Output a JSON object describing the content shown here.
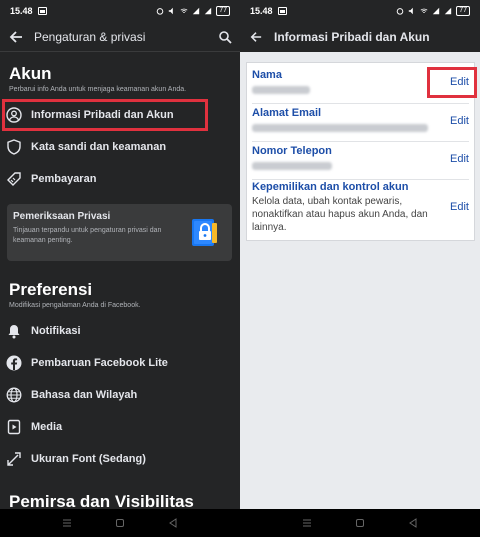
{
  "left": {
    "status": {
      "time": "15.48",
      "battery": "77"
    },
    "header": {
      "title": "Pengaturan & privasi"
    },
    "akun": {
      "title": "Akun",
      "subtitle": "Perbarui info Anda untuk menjaga keamanan akun Anda.",
      "items": [
        {
          "label": "Informasi Pribadi dan Akun",
          "icon": "user-circle-icon"
        },
        {
          "label": "Kata sandi dan keamanan",
          "icon": "shield-icon"
        },
        {
          "label": "Pembayaran",
          "icon": "tag-icon"
        }
      ]
    },
    "privacy_card": {
      "title": "Pemeriksaan Privasi",
      "description": "Tinjauan terpandu untuk pengaturan privasi dan keamanan penting."
    },
    "preferensi": {
      "title": "Preferensi",
      "subtitle": "Modifikasi pengalaman Anda di Facebook.",
      "items": [
        {
          "label": "Notifikasi",
          "icon": "bell-icon"
        },
        {
          "label": "Pembaruan Facebook Lite",
          "icon": "facebook-icon"
        },
        {
          "label": "Bahasa dan Wilayah",
          "icon": "globe-icon"
        },
        {
          "label": "Media",
          "icon": "media-icon"
        },
        {
          "label": "Ukuran Font (Sedang)",
          "icon": "font-size-icon"
        }
      ]
    },
    "partial_section_title": "Pemirsa dan Visibilitas"
  },
  "right": {
    "status": {
      "time": "15.48",
      "battery": "77"
    },
    "header": {
      "title": "Informasi Pribadi dan Akun"
    },
    "rows": [
      {
        "label": "Nama",
        "edit": "Edit"
      },
      {
        "label": "Alamat Email",
        "edit": "Edit"
      },
      {
        "label": "Nomor Telepon",
        "edit": "Edit"
      },
      {
        "label": "Kepemilikan dan kontrol akun",
        "description": "Kelola data, ubah kontak pewaris, nonaktifkan atau hapus akun Anda, dan lainnya.",
        "edit": "Edit"
      }
    ]
  },
  "colors": {
    "highlight": "#e0313e",
    "link": "#1d4ea8",
    "dark_bg": "#242526"
  }
}
